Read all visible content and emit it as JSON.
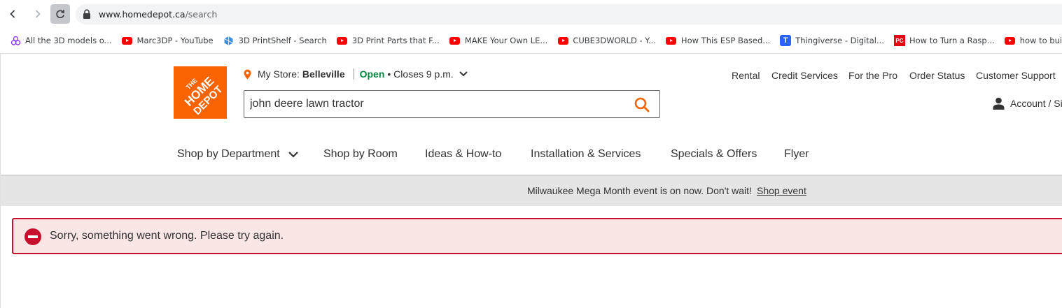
{
  "browser": {
    "url_host": "www.homedepot.ca",
    "url_path": "/search",
    "bookmarks": [
      {
        "icon": "3d-model-icon",
        "label": "All the 3D models o..."
      },
      {
        "icon": "youtube-icon",
        "label": "Marc3DP - YouTube"
      },
      {
        "icon": "printshelf-icon",
        "label": "3D PrintShelf - Search"
      },
      {
        "icon": "youtube-icon",
        "label": "3D Print Parts that F..."
      },
      {
        "icon": "youtube-icon",
        "label": "MAKE Your Own LE..."
      },
      {
        "icon": "youtube-icon",
        "label": "CUBE3DWORLD - Y..."
      },
      {
        "icon": "youtube-icon",
        "label": "How This ESP Based..."
      },
      {
        "icon": "thingiverse-icon",
        "label": "Thingiverse - Digital..."
      },
      {
        "icon": "pcmag-icon",
        "label": "How to Turn a Rasp..."
      },
      {
        "icon": "youtube-icon",
        "label": "how to build a Rasp..."
      }
    ]
  },
  "header": {
    "logo_text": "THE HOME DEPOT",
    "store": {
      "prefix": "My Store:",
      "name": "Belleville",
      "status": "Open",
      "hours": "• Closes 9 p.m."
    },
    "search": {
      "value": "john deere lawn tractor",
      "placeholder": ""
    },
    "utility_links": [
      "Rental",
      "Credit Services",
      "For the Pro",
      "Order Status",
      "Customer Support"
    ],
    "account_label": "Account / Si"
  },
  "nav": [
    "Shop by Department",
    "Shop by Room",
    "Ideas & How-to",
    "Installation & Services",
    "Specials & Offers",
    "Flyer"
  ],
  "promo": {
    "text": "Milwaukee Mega Month event is on now. Don't wait!",
    "link": "Shop event"
  },
  "alert": {
    "message": "Sorry, something went wrong. Please try again."
  },
  "colors": {
    "brand_orange": "#f96302",
    "open_green": "#00873c",
    "error_red": "#c8102e",
    "error_bg": "#fbe6e6"
  }
}
